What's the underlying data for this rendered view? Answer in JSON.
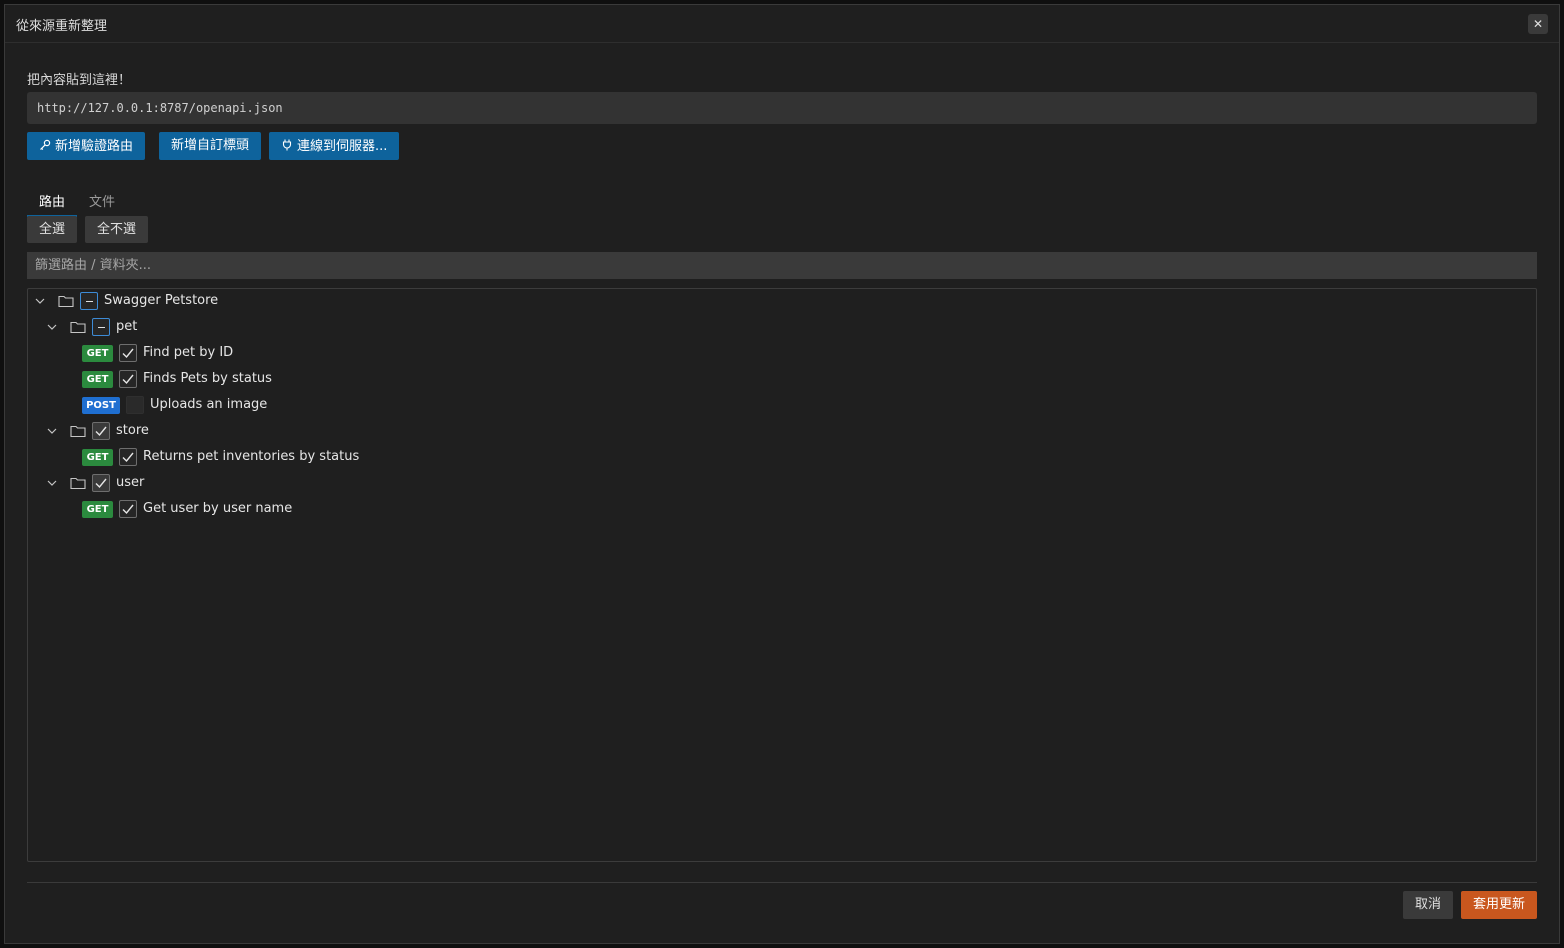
{
  "dialog": {
    "title": "從來源重新整理",
    "close_symbol": "✕"
  },
  "source": {
    "label": "把內容貼到這裡！",
    "url_value": "http://127.0.0.1:8787/openapi.json"
  },
  "actions": {
    "add_auth_route": "新增驗證路由",
    "add_auth_route_icon": "key-icon",
    "add_custom_header": "新增自訂標頭",
    "connect_server": "連線到伺服器...",
    "connect_server_icon": "plug-icon"
  },
  "tabs": [
    {
      "label": "路由",
      "active": true
    },
    {
      "label": "文件",
      "active": false
    }
  ],
  "selection": {
    "select_all": "全選",
    "select_none": "全不選"
  },
  "filter": {
    "placeholder": "篩選路由 / 資料夾..."
  },
  "tree": {
    "root": {
      "label": "Swagger Petstore",
      "state": "indeterminate"
    },
    "folders": [
      {
        "label": "pet",
        "state": "indeterminate",
        "routes": [
          {
            "method": "GET",
            "label": "Find pet by ID",
            "checked": true
          },
          {
            "method": "GET",
            "label": "Finds Pets by status",
            "checked": true
          },
          {
            "method": "POST",
            "label": "Uploads an image",
            "checked": false
          }
        ]
      },
      {
        "label": "store",
        "state": "checked",
        "routes": [
          {
            "method": "GET",
            "label": "Returns pet inventories by status",
            "checked": true
          }
        ]
      },
      {
        "label": "user",
        "state": "checked",
        "routes": [
          {
            "method": "GET",
            "label": "Get user by user name",
            "checked": true
          }
        ]
      }
    ]
  },
  "footer": {
    "cancel": "取消",
    "apply": "套用更新"
  },
  "colors": {
    "accent_blue": "#0e639c",
    "get_badge": "#2b8a3e",
    "post_badge": "#1f6fd1",
    "apply_button": "#c9571e"
  }
}
